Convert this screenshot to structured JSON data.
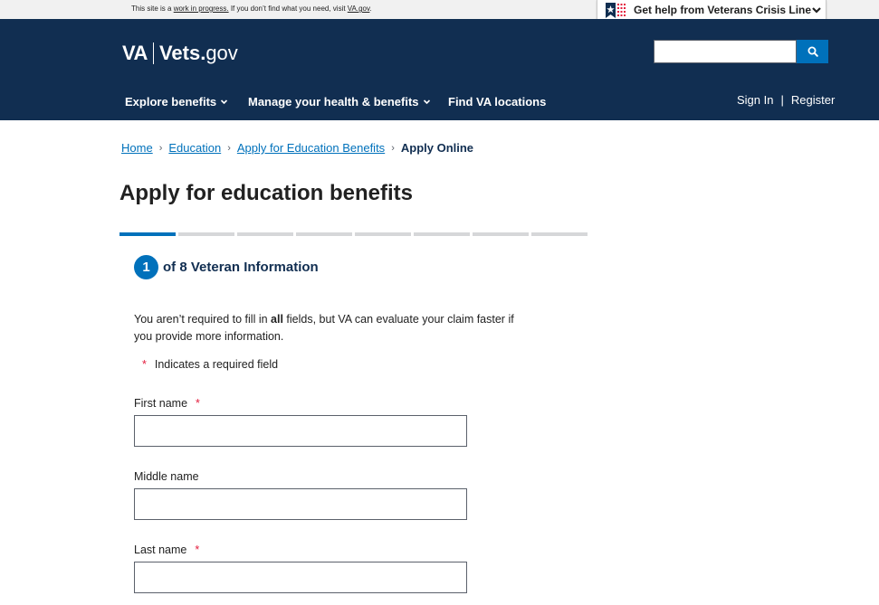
{
  "topbar": {
    "text_before": "This site is a ",
    "wip_link": "work in progress.",
    "text_middle": " If you don’t find what you need, visit ",
    "va_link": "VA.gov",
    "text_after": ".",
    "crisis_label": "Get help from Veterans Crisis Line"
  },
  "header": {
    "logo_va": "VA",
    "logo_vets": "Vets.",
    "logo_gov": "gov",
    "search": {
      "value": "",
      "placeholder": ""
    },
    "nav": {
      "explore": "Explore benefits",
      "manage": "Manage your health & benefits",
      "find": "Find VA locations"
    },
    "auth": {
      "sign_in": "Sign In",
      "separator": "|",
      "register": "Register"
    }
  },
  "breadcrumb": {
    "items": [
      "Home",
      "Education",
      "Apply for Education Benefits"
    ],
    "current": "Apply Online",
    "separator": "›"
  },
  "page": {
    "title": "Apply for education benefits",
    "progress": {
      "current_step": 1,
      "total_steps": 8
    },
    "step_number": "1",
    "step_text": "of 8 Veteran Information"
  },
  "form": {
    "intro_before": "You aren’t required to fill in ",
    "intro_bold": "all",
    "intro_after": " fields, but VA can evaluate your claim faster if you provide more information.",
    "required_marker": "*",
    "required_note": "Indicates a required field",
    "fields": [
      {
        "label": "First name",
        "required": true,
        "value": ""
      },
      {
        "label": "Middle name",
        "required": false,
        "value": ""
      },
      {
        "label": "Last name",
        "required": true,
        "value": ""
      }
    ]
  },
  "colors": {
    "header_bg": "#112e51",
    "primary": "#0071bb",
    "required": "#e31c3d",
    "progress_inactive": "#d6d7d9"
  }
}
